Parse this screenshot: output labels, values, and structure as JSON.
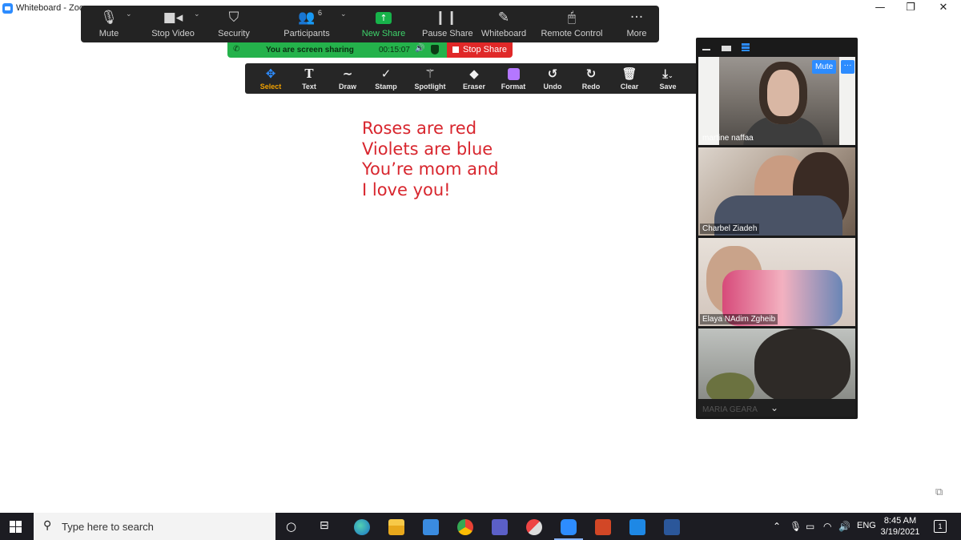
{
  "window": {
    "title": "Whiteboard - Zoo",
    "minimize": "—",
    "restore": "❐",
    "close": "✕"
  },
  "meeting_toolbar": {
    "mute": "Mute",
    "stop_video": "Stop Video",
    "security": "Security",
    "participants": "Participants",
    "participants_count": "6",
    "new_share": "New Share",
    "pause_share": "Pause Share",
    "whiteboard": "Whiteboard",
    "remote_control": "Remote Control",
    "more": "More"
  },
  "share_banner": {
    "message": "You are screen sharing",
    "elapsed": "00:15:07",
    "stop_label": "Stop Share",
    "color": "#24b24b",
    "stop_color": "#e02828"
  },
  "annotation_toolbar": {
    "tools": [
      {
        "label": "Select",
        "icon": "move-arrows-icon"
      },
      {
        "label": "Text",
        "icon": "text-icon"
      },
      {
        "label": "Draw",
        "icon": "squiggle-icon"
      },
      {
        "label": "Stamp",
        "icon": "checkmark-icon"
      },
      {
        "label": "Spotlight",
        "icon": "spotlight-wand-icon"
      },
      {
        "label": "Eraser",
        "icon": "eraser-icon"
      },
      {
        "label": "Format",
        "icon": "format-color-icon"
      },
      {
        "label": "Undo",
        "icon": "undo-icon"
      },
      {
        "label": "Redo",
        "icon": "redo-icon"
      },
      {
        "label": "Clear",
        "icon": "trash-icon"
      },
      {
        "label": "Save",
        "icon": "save-download-icon"
      }
    ],
    "selected": "Select",
    "format_color": "#b477ff"
  },
  "whiteboard": {
    "lines": [
      "Roses are red",
      "Violets are blue",
      "You’re mom and",
      "I love you!"
    ],
    "ink_color": "#d8262e"
  },
  "gallery": {
    "participants": [
      {
        "name": "martine naffaa"
      },
      {
        "name": "Charbel Ziadeh"
      },
      {
        "name": "Elaya NAdim Zgheib"
      },
      {
        "name": "MARIA GEARA"
      }
    ],
    "mute_label": "Mute",
    "more_label": "···"
  },
  "taskbar": {
    "search_placeholder": "Type here to search",
    "language": "ENG",
    "time": "8:45 AM",
    "date": "3/19/2021",
    "notification_count": "1"
  }
}
